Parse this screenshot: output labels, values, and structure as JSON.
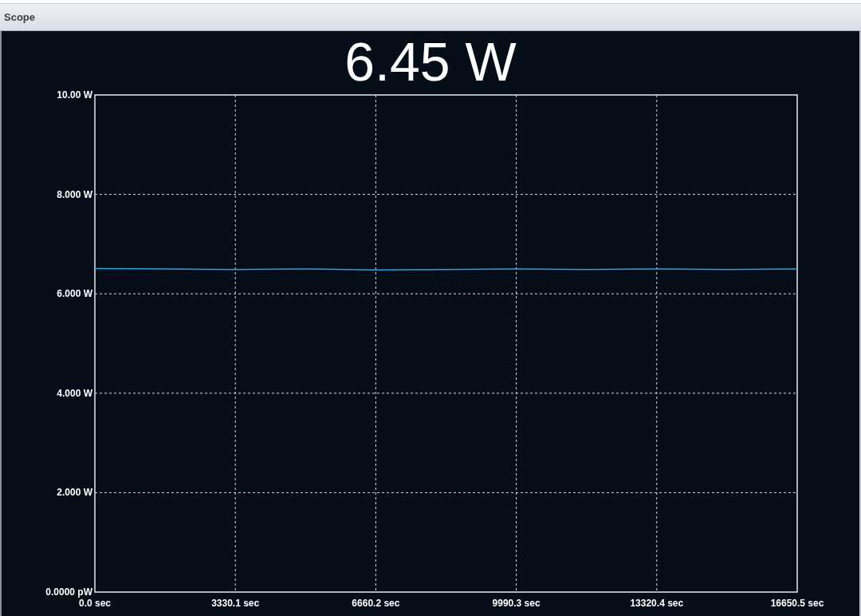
{
  "window": {
    "title": "Scope"
  },
  "reading": "6.45 W",
  "chart": {
    "chart_data": {
      "type": "line",
      "x": [
        0,
        1665,
        3330.1,
        4995,
        6660.2,
        8325,
        9990.3,
        11655,
        13320.4,
        14985,
        16650.5
      ],
      "grid": true,
      "series": [
        {
          "color": "#29a3e0",
          "values": [
            6.51,
            6.5,
            6.49,
            6.5,
            6.48,
            6.49,
            6.5,
            6.49,
            6.5,
            6.49,
            6.5
          ]
        }
      ],
      "xlim": [
        0,
        16650.5
      ],
      "ylim": [
        0,
        10
      ],
      "xticks": [
        {
          "value": 0,
          "label": "0.0 sec"
        },
        {
          "value": 3330.1,
          "label": "3330.1 sec"
        },
        {
          "value": 6660.2,
          "label": "6660.2 sec"
        },
        {
          "value": 9990.3,
          "label": "9990.3 sec"
        },
        {
          "value": 13320.4,
          "label": "13320.4 sec"
        },
        {
          "value": 16650.5,
          "label": "16650.5 sec"
        }
      ],
      "yticks": [
        {
          "value": 0,
          "label": "0.0000 pW"
        },
        {
          "value": 2,
          "label": "2.000 W"
        },
        {
          "value": 4,
          "label": "4.000 W"
        },
        {
          "value": 6,
          "label": "6.000 W"
        },
        {
          "value": 8,
          "label": "8.000 W"
        },
        {
          "value": 10,
          "label": "10.00 W"
        }
      ]
    }
  }
}
